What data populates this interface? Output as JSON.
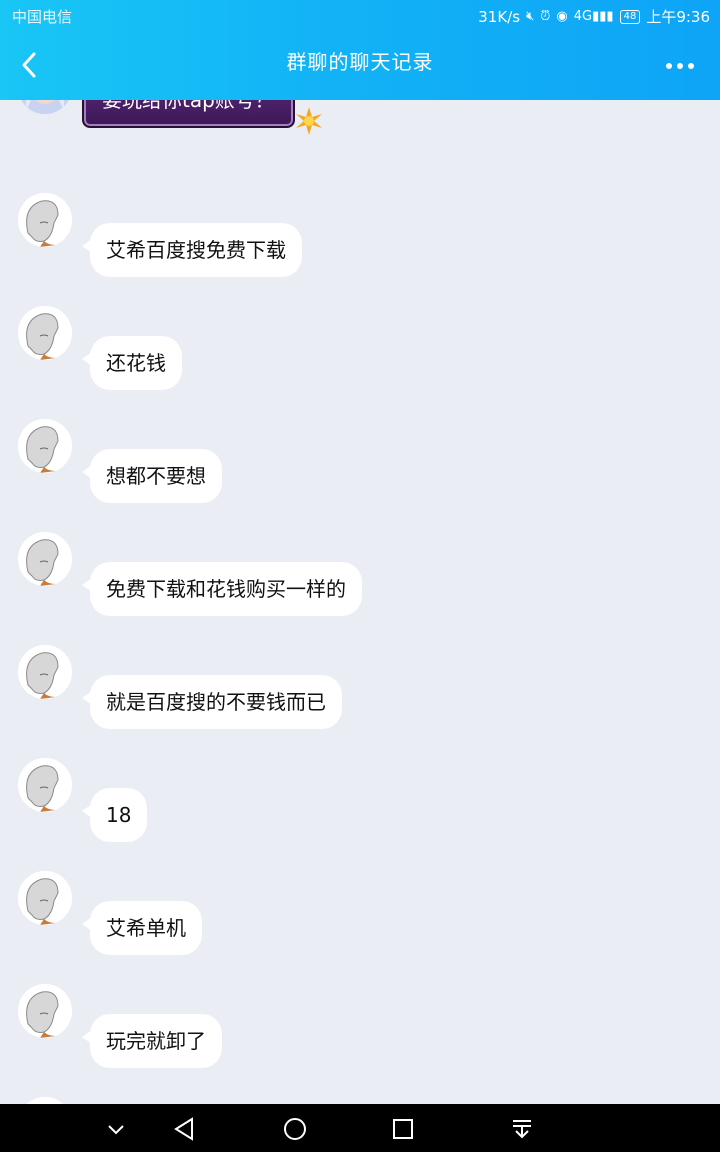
{
  "status_bar": {
    "carrier": "中国电信",
    "speed": "31K/s",
    "signal": "4G",
    "battery": "48",
    "time": "上午9:36"
  },
  "header": {
    "title": "群聊的聊天记录"
  },
  "messages": [
    {
      "text": "要玩给你tap账号？"
    },
    {
      "text": "艾希百度搜免费下载"
    },
    {
      "text": "还花钱"
    },
    {
      "text": "想都不要想"
    },
    {
      "text": "免费下载和花钱购买一样的"
    },
    {
      "text": "就是百度搜的不要钱而已"
    },
    {
      "text": "18"
    },
    {
      "text": "艾希单机"
    },
    {
      "text": "玩完就卸了"
    }
  ],
  "colors": {
    "header_start": "#19c6f5",
    "header_end": "#0ea4f7",
    "chat_bg": "#eaedf4",
    "special_bubble": "#4a2169"
  },
  "icons": [
    "back-arrow-icon",
    "more-dots-icon",
    "mute-icon",
    "alarm-icon",
    "eye-icon",
    "signal-icon",
    "battery-icon",
    "nav-collapse-icon",
    "nav-back-icon",
    "nav-home-icon",
    "nav-recent-icon",
    "nav-notification-icon"
  ]
}
